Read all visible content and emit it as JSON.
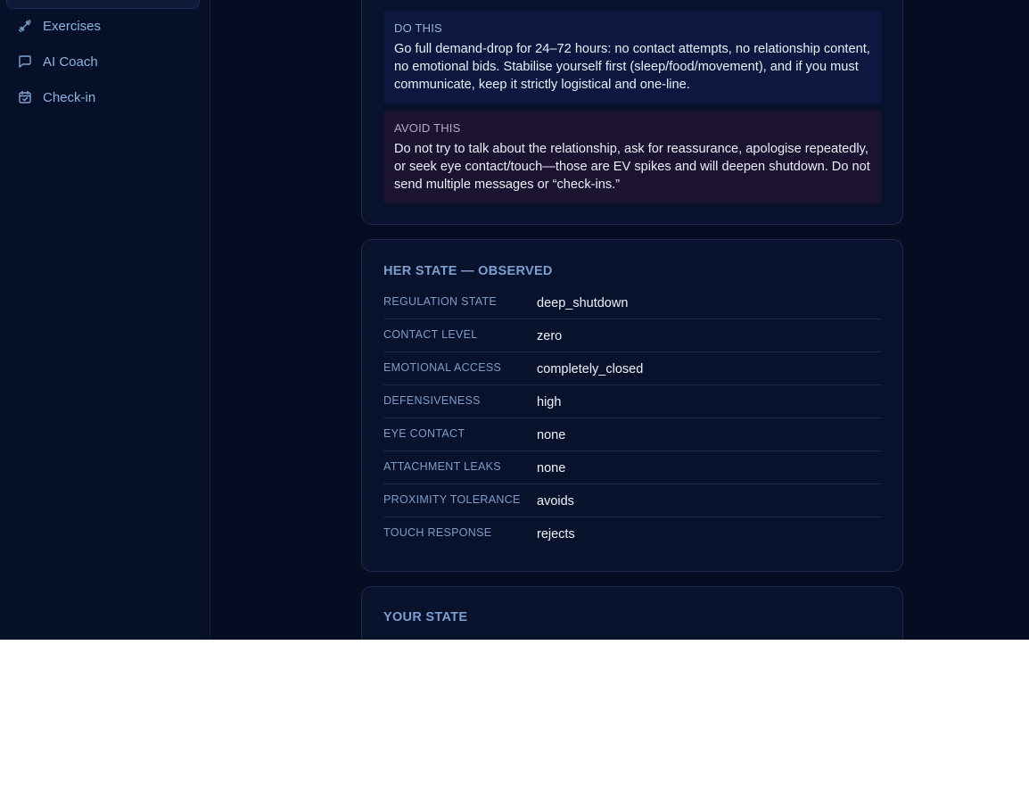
{
  "sidebar": {
    "items": [
      {
        "label": "Exercises",
        "icon": "dumbbell-icon"
      },
      {
        "label": "AI Coach",
        "icon": "message-square-icon"
      },
      {
        "label": "Check-in",
        "icon": "calendar-check-icon"
      }
    ]
  },
  "advice": {
    "do_tag": "DO THIS",
    "do_body": "Go full demand-drop for 24–72 hours: no contact attempts, no relationship content, no emotional bids. Stabilise yourself first (sleep/food/movement), and if you must communicate, keep it strictly logistical and one-line.",
    "avoid_tag": "AVOID THIS",
    "avoid_body": "Do not try to talk about the relationship, ask for reassurance, apologise repeatedly, or seek eye contact/touch—those are EV spikes and will deepen shutdown. Do not send multiple messages or “check-ins.”"
  },
  "her_state": {
    "title": "HER STATE — OBSERVED",
    "rows": [
      {
        "key": "REGULATION STATE",
        "value": "deep_shutdown"
      },
      {
        "key": "CONTACT LEVEL",
        "value": "zero"
      },
      {
        "key": "EMOTIONAL ACCESS",
        "value": "completely_closed"
      },
      {
        "key": "DEFENSIVENESS",
        "value": "high"
      },
      {
        "key": "EYE CONTACT",
        "value": "none"
      },
      {
        "key": "ATTACHMENT LEAKS",
        "value": "none"
      },
      {
        "key": "PROXIMITY TOLERANCE",
        "value": "avoids"
      },
      {
        "key": "TOUCH RESPONSE",
        "value": "rejects"
      }
    ]
  },
  "your_state": {
    "title": "YOUR STATE"
  },
  "colors": {
    "background": "#060c22",
    "sidebar": "#071029",
    "card": "#09122d",
    "do_panel": "#0d1840",
    "avoid_panel": "#1c1330",
    "accent_text": "#7d9fce"
  }
}
